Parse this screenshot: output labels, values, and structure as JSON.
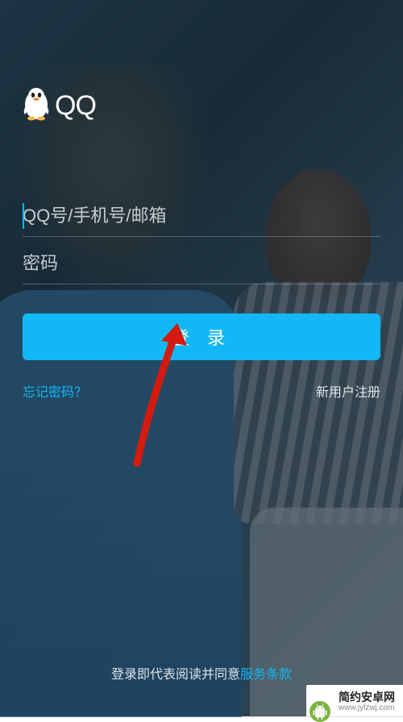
{
  "logo": {
    "text": "QQ"
  },
  "form": {
    "account": {
      "placeholder": "QQ号/手机号/邮箱",
      "value": ""
    },
    "password": {
      "placeholder": "密码",
      "value": ""
    },
    "login_button": "登 录"
  },
  "links": {
    "forgot_password": "忘记密码？",
    "register": "新用户注册"
  },
  "footer": {
    "prefix": "登录即代表阅读并同意",
    "terms_link": "服务条款"
  },
  "watermark": {
    "name": "简约安卓网",
    "url": "www.jylzwj.com"
  },
  "colors": {
    "accent": "#12b7f5",
    "annotation": "#d41b0f"
  }
}
